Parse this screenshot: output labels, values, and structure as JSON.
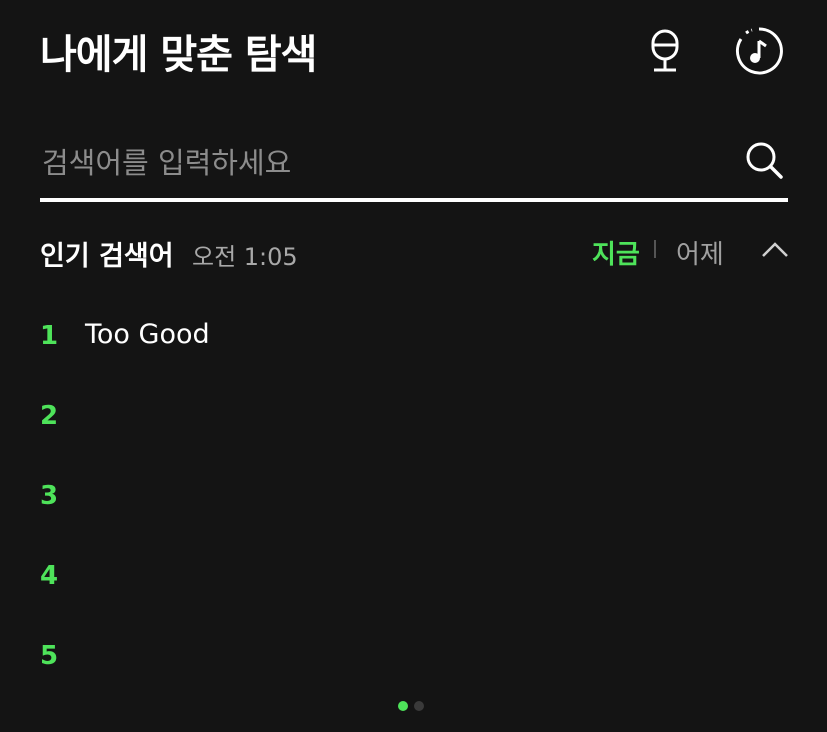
{
  "header": {
    "title": "나에게 맞춘 탐색",
    "mic_icon": "microphone-icon",
    "music_icon": "music-recognition-icon"
  },
  "search": {
    "placeholder": "검색어를 입력하세요",
    "value": "",
    "icon": "search-icon"
  },
  "popular": {
    "title": "인기 검색어",
    "time": "오전 1:05",
    "tabs": {
      "now": "지금",
      "yesterday": "어제"
    },
    "collapse_icon": "chevron-up-icon",
    "items": [
      {
        "rank": "1",
        "term": "Too Good"
      },
      {
        "rank": "2",
        "term": ""
      },
      {
        "rank": "3",
        "term": ""
      },
      {
        "rank": "4",
        "term": ""
      },
      {
        "rank": "5",
        "term": ""
      }
    ]
  },
  "pagination": {
    "current": 1,
    "total": 2
  },
  "colors": {
    "accent": "#4ee35a",
    "background": "#141414",
    "text": "#ffffff",
    "muted": "#a8a8a8"
  }
}
